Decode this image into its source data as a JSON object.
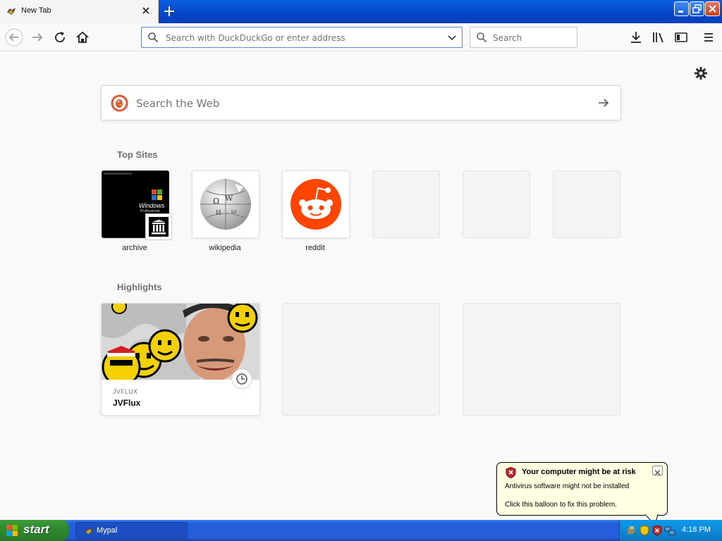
{
  "browser": {
    "tab": {
      "title": "New Tab",
      "favicon": "mypal-icon"
    },
    "urlbar": {
      "placeholder": "Search with DuckDuckGo or enter address",
      "value": ""
    },
    "searchbar": {
      "placeholder": "Search",
      "value": ""
    }
  },
  "newtab": {
    "websearch": {
      "placeholder": "Search the Web"
    },
    "top_sites_title": "Top Sites",
    "top_sites": [
      {
        "label": "archive"
      },
      {
        "label": "wikipedia"
      },
      {
        "label": "reddit"
      }
    ],
    "highlights_title": "Highlights",
    "highlights": [
      {
        "source": "JVFLUX",
        "title": "JVFlux"
      }
    ]
  },
  "balloon": {
    "title": "Your computer might be at risk",
    "line1": "Antivirus software might not be installed",
    "line2": "Click this balloon to fix this problem."
  },
  "taskbar": {
    "start_label": "start",
    "window_label": "Mypal",
    "clock": "4:18 PM"
  },
  "colors": {
    "xp_blue": "#245edb",
    "start_green": "#2f8a2f",
    "reddit_orange": "#ff4500",
    "balloon_bg": "#ffffe1"
  }
}
